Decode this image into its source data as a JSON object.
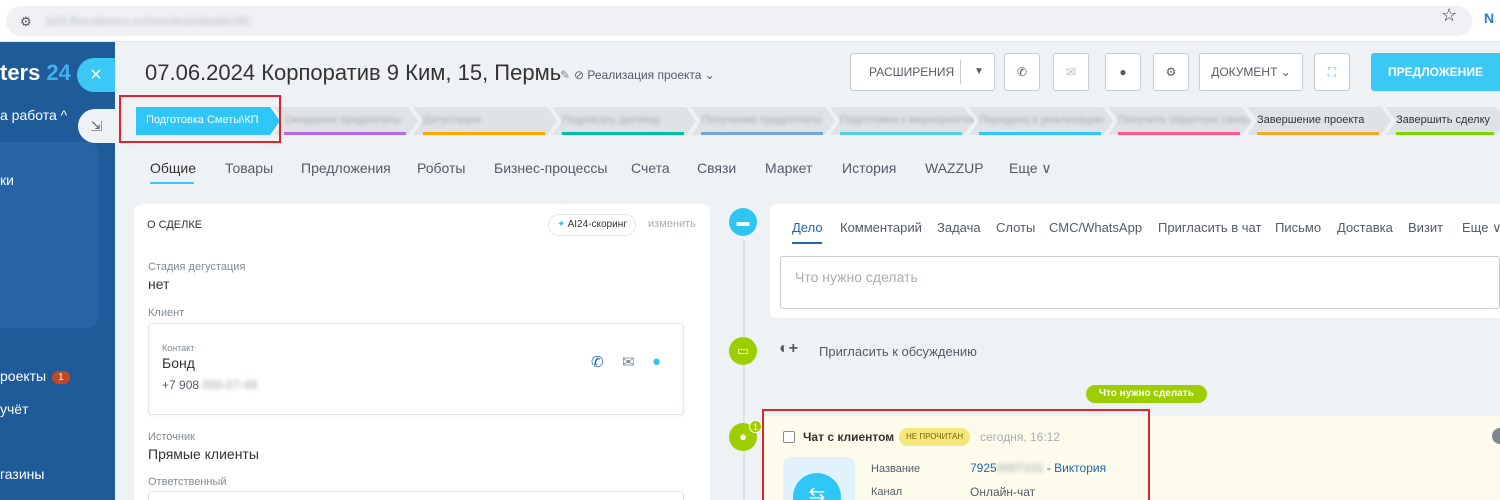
{
  "browser": {
    "url": "b24.fhecaterers.ru/crm/deal/details/45/",
    "ext_label": "N"
  },
  "sidebar": {
    "logo_text": "ters",
    "logo_num": "24",
    "close_symbol": "×",
    "items": [
      {
        "label": "а работа ^"
      },
      {
        "label": "ки"
      },
      {
        "label": "роекты",
        "badge": "1"
      },
      {
        "label": "учёт"
      },
      {
        "label": "газины"
      }
    ]
  },
  "header": {
    "title": "07.06.2024 Корпоратив 9 Ким, 15, Пермь",
    "category": "Реализация проекта",
    "buttons": {
      "extensions": "РАСШИРЕНИЯ",
      "document": "ДОКУМЕНТ",
      "offer": "ПРЕДЛОЖЕНИЕ"
    }
  },
  "pipeline": {
    "stages": [
      {
        "label": "Подготовка Сметы\\КП",
        "color": "#2fc6f6",
        "active": true,
        "blurred": false
      },
      {
        "label": "Ожидание предоплаты",
        "color": "#b36be5",
        "active": false,
        "blurred": true
      },
      {
        "label": "Дегустация",
        "color": "#ffa900",
        "active": false,
        "blurred": true
      },
      {
        "label": "Подписать договор",
        "color": "#00bfa5",
        "active": false,
        "blurred": true
      },
      {
        "label": "Получение предоплаты",
        "color": "#6fa8dc",
        "active": false,
        "blurred": true
      },
      {
        "label": "Подготовка к мероприятию",
        "color": "#55d0e0",
        "active": false,
        "blurred": true
      },
      {
        "label": "Передача в реализацию",
        "color": "#2fc6f6",
        "active": false,
        "blurred": true
      },
      {
        "label": "Получить обратную связь",
        "color": "#ff5a8a",
        "active": false,
        "blurred": true
      },
      {
        "label": "Завершение проекта",
        "color": "#f5a623",
        "active": false,
        "blurred": false
      },
      {
        "label": "Завершить сделку",
        "color": "#7bd500",
        "active": false,
        "blurred": false
      }
    ]
  },
  "tabs": [
    "Общие",
    "Товары",
    "Предложения",
    "Роботы",
    "Бизнес-процессы",
    "Счета",
    "Связи",
    "Маркет",
    "История",
    "WAZZUP",
    "Еще ∨"
  ],
  "deal_card": {
    "title": "О СДЕЛКЕ",
    "ai_label": "AI24-скоринг",
    "edit_label": "изменить",
    "tasting_label": "Стадия дегустация",
    "tasting_value": "нет",
    "client_label": "Клиент",
    "contact_label": "Контакт",
    "contact_name": "Бонд",
    "contact_phone_prefix": "+7 908",
    "contact_phone_hidden": "000-07-49",
    "source_label": "Источник",
    "source_value": "Прямые клиенты",
    "responsible_label": "Ответственный"
  },
  "composer": {
    "tabs": [
      "Дело",
      "Комментарий",
      "Задача",
      "Слоты",
      "СМС/WhatsApp",
      "Пригласить в чат",
      "Письмо",
      "Доставка",
      "Визит",
      "Еще ∨"
    ],
    "placeholder": "Что нужно сделать"
  },
  "timeline": {
    "invite_text": "Пригласить к обсуждению",
    "todo_label": "Что нужно сделать",
    "chat_badge": "1",
    "chat": {
      "title": "Чат с клиентом",
      "status": "НЕ ПРОЧИТАН",
      "time": "сегодня, 16:12",
      "name_label": "Название",
      "name_prefix": "7925",
      "name_hidden": "0007101",
      "name_suffix": " - Виктория",
      "channel_label": "Канал",
      "channel_value": "Онлайн-чат"
    }
  },
  "colors": {
    "sidebar": "#1f5a99",
    "accent": "#3bc8f5",
    "timeline_green": "#9dcf00",
    "highlight_red": "#e0242a"
  }
}
